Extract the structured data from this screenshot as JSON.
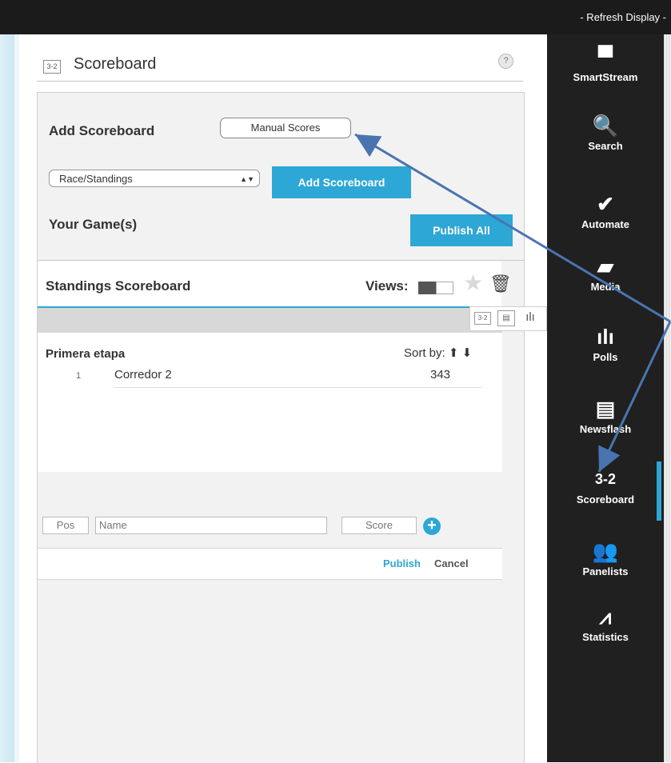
{
  "topbar": {
    "refresh_label": "- Refresh Display -"
  },
  "header": {
    "icon_text": "3-2",
    "title": "Scoreboard",
    "help_label": "?"
  },
  "add_section": {
    "label": "Add Scoreboard",
    "mode_pill": "Manual Scores",
    "type_select": {
      "value": "Race/Standings",
      "caret": "▲▼"
    },
    "add_button": "Add Scoreboard"
  },
  "games": {
    "label": "Your Game(s)",
    "publish_all": "Publish All"
  },
  "scoreboard": {
    "title": "Standings Scoreboard",
    "views_label": "Views:",
    "toolbox": {
      "score_icon_text": "3-2",
      "news_icon_text": "▤",
      "poll_icon_text": "ılı"
    },
    "stage_name": "Primera etapa",
    "sort_by": "Sort by: ⬆ ⬇",
    "rows": [
      {
        "rank": "1",
        "name": "Corredor 2",
        "score": "343"
      }
    ],
    "entry": {
      "pos_placeholder": "Pos",
      "name_placeholder": "Name",
      "score_placeholder": "Score",
      "plus": "+"
    },
    "publish": "Publish",
    "cancel": "Cancel"
  },
  "sidebar": {
    "items": [
      {
        "label": "SmartStream",
        "icon": "▀"
      },
      {
        "label": "Search",
        "icon": "🔍"
      },
      {
        "label": "Automate",
        "icon": "✔"
      },
      {
        "label": "Media",
        "icon": "▰"
      },
      {
        "label": "Polls",
        "icon": "ılı"
      },
      {
        "label": "Newsflash",
        "icon": "▤"
      },
      {
        "label": "Scoreboard",
        "icon": "3-2"
      },
      {
        "label": "Panelists",
        "icon": "👥"
      },
      {
        "label": "Statistics",
        "icon": "⩘"
      }
    ],
    "active": "Scoreboard"
  },
  "colors": {
    "accent": "#2da7d6",
    "sidebar_bg": "#202020",
    "topbar_bg": "#1b1b1b",
    "annotation_arrow": "#4a74b0"
  }
}
